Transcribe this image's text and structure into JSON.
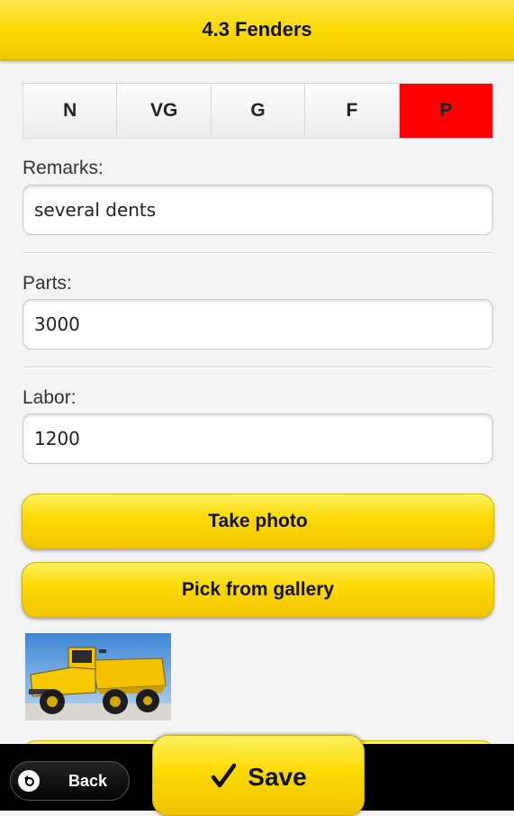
{
  "header": {
    "title": "4.3 Fenders"
  },
  "rating": {
    "options": [
      "N",
      "VG",
      "G",
      "F",
      "P"
    ],
    "selected": "P",
    "selected_color": "#ff0000"
  },
  "remarks": {
    "label": "Remarks:",
    "value": "several dents"
  },
  "parts": {
    "label": "Parts:",
    "value": "3000"
  },
  "labor": {
    "label": "Labor:",
    "value": "1200"
  },
  "buttons": {
    "take_photo": "Take photo",
    "pick_gallery": "Pick from gallery"
  },
  "photo": {
    "icon": "truck-photo"
  },
  "footer": {
    "back_label": "Back",
    "back_icon": "back-arrow-icon",
    "save_label": "Save",
    "save_icon": "checkmark-icon"
  },
  "colors": {
    "accent": "#fbd900",
    "footer": "#000000"
  }
}
